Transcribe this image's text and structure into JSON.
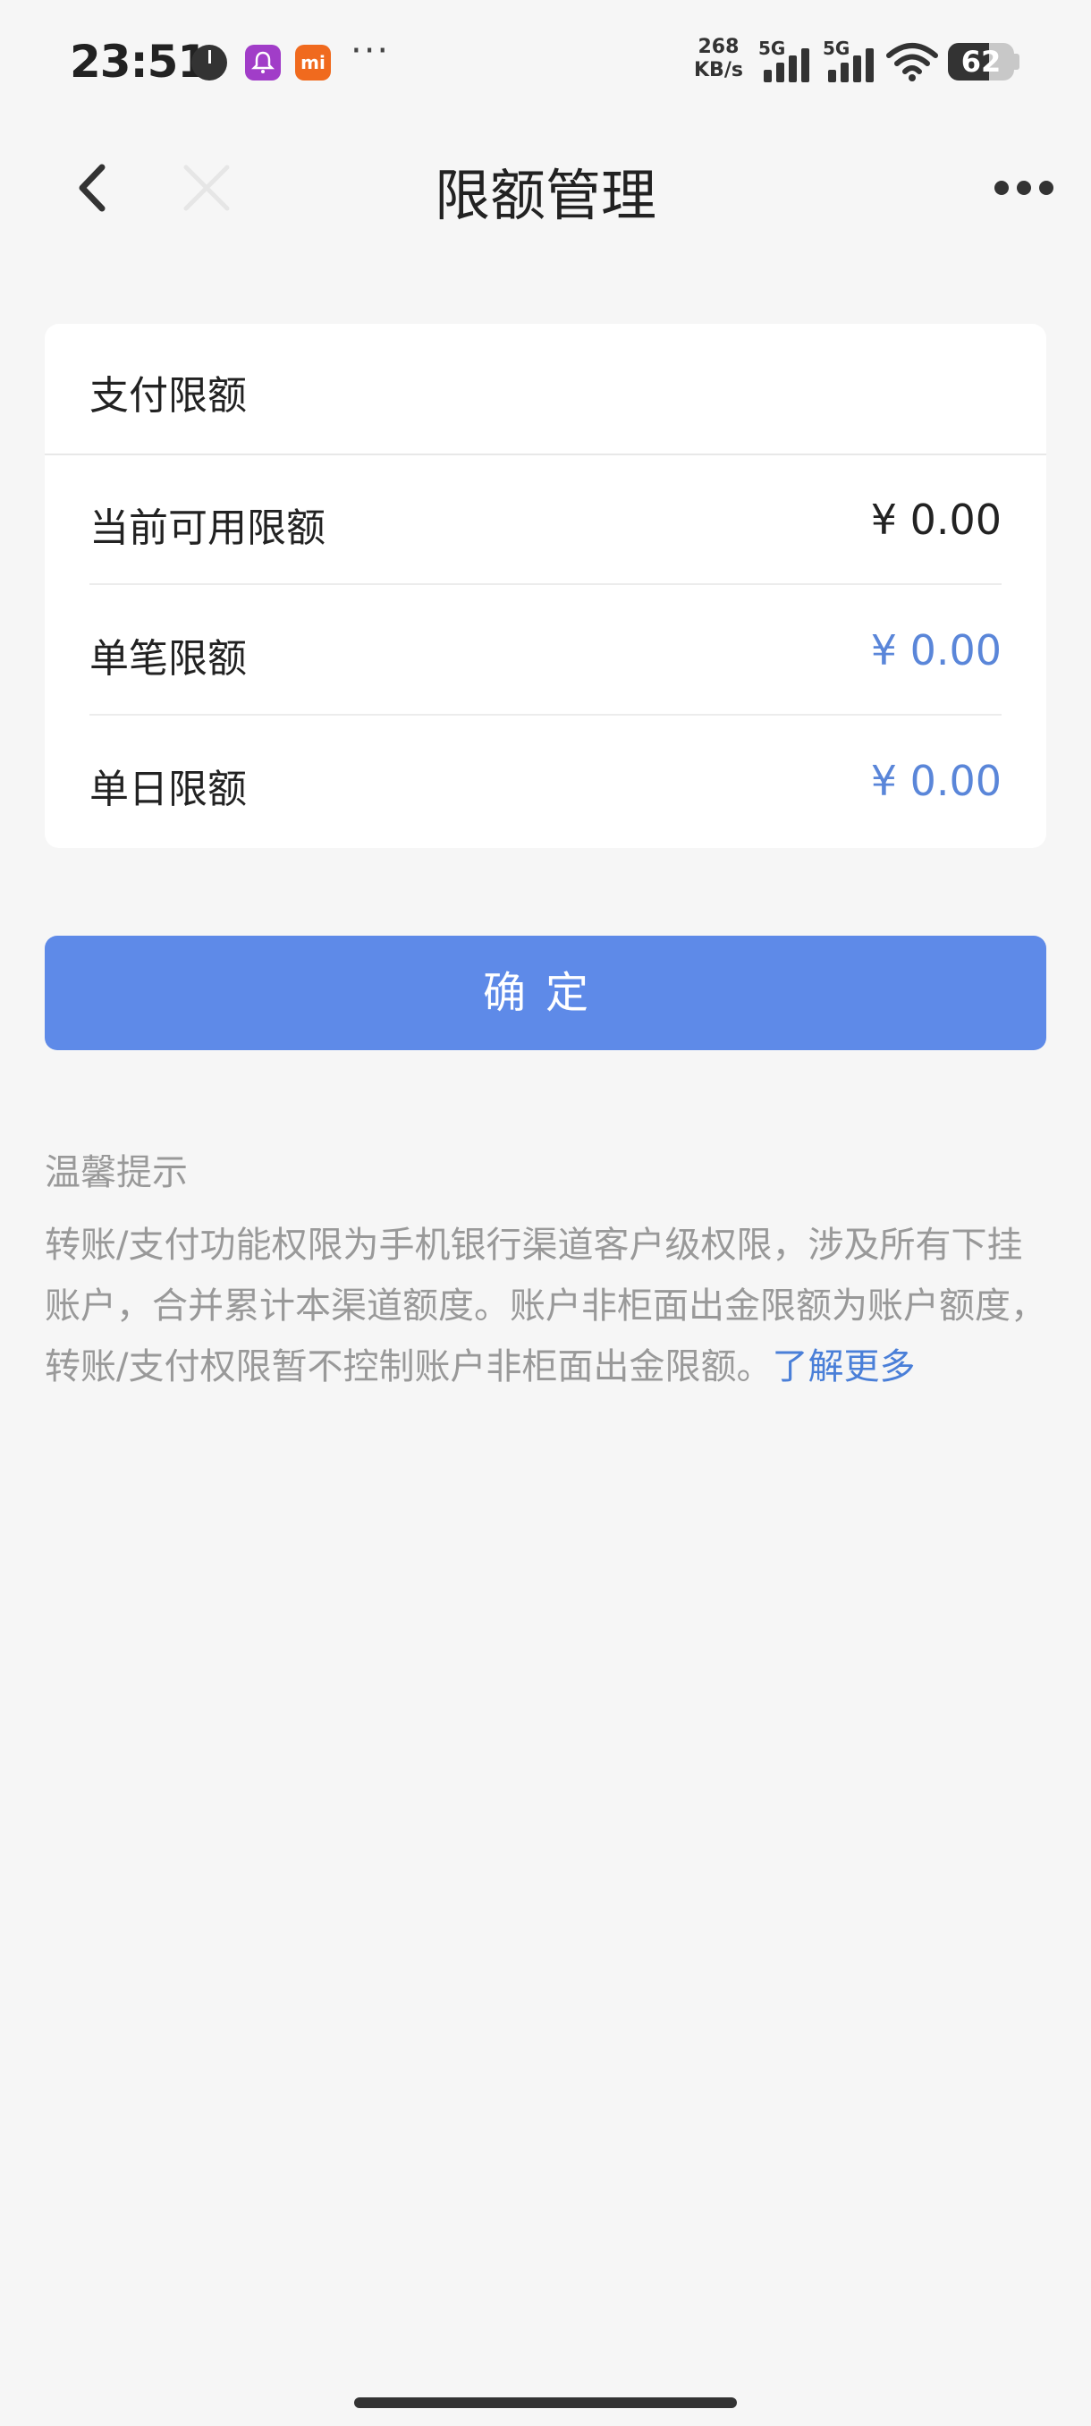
{
  "status_bar": {
    "time": "23:51",
    "net_speed_value": "268",
    "net_speed_unit": "KB/s",
    "sim1_label": "5G",
    "sim2_label": "5G",
    "battery": "62",
    "battery_level": 0.62
  },
  "nav": {
    "title": "限额管理"
  },
  "card": {
    "title": "支付限额",
    "rows": [
      {
        "label": "当前可用限额",
        "value": "¥ 0.00"
      },
      {
        "label": "单笔限额",
        "value": "¥ 0.00"
      },
      {
        "label": "单日限额",
        "value": "¥ 0.00"
      }
    ]
  },
  "confirm_label": "确定",
  "tips": {
    "title": "温馨提示",
    "body": "转账/支付功能权限为手机银行渠道客户级权限，涉及所有下挂账户，合并累计本渠道额度。账户非柜面出金限额为账户额度，转账/支付权限暂不控制账户非柜面出金限额。",
    "link": "了解更多"
  },
  "colors": {
    "accent": "#5e8ae8",
    "link": "#4a7fd8",
    "background": "#f6f6f6"
  }
}
